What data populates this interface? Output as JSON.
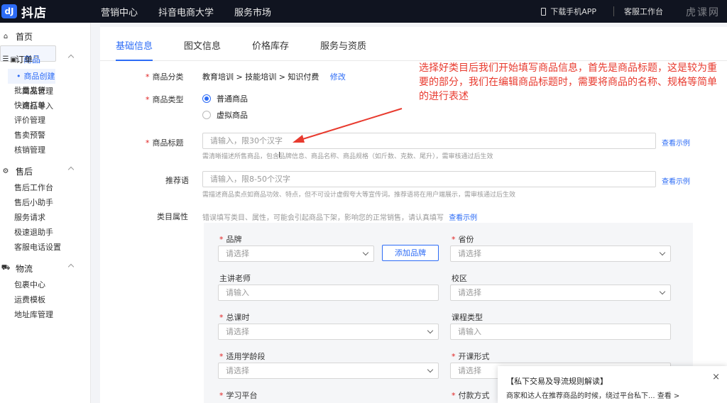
{
  "topbar": {
    "logo_mark": "dJ",
    "logo_text": "抖店",
    "nav": [
      "营销中心",
      "抖音电商大学",
      "服务市场"
    ],
    "download_app": "下载手机APP",
    "customer_service": "客服工作台",
    "watermark": "虎课网"
  },
  "sidebar": {
    "home": "首页",
    "groups": [
      {
        "title": "商品",
        "items": [
          "商品创建",
          "商品管理",
          "商品导入"
        ]
      },
      {
        "title": "订单",
        "items": [
          "订单管理",
          "批量发货",
          "快速打单",
          "评价管理",
          "售卖预警",
          "核销管理"
        ]
      },
      {
        "title": "售后",
        "items": [
          "售后工作台",
          "售后小助手",
          "服务请求",
          "极速退助手",
          "客服电话设置"
        ]
      },
      {
        "title": "物流",
        "items": [
          "包裹中心",
          "运费模板",
          "地址库管理"
        ]
      }
    ]
  },
  "tabs": [
    "基础信息",
    "图文信息",
    "价格库存",
    "服务与资质"
  ],
  "form": {
    "category_label": "商品分类",
    "category_value": "教育培训 > 技能培训 > 知识付费",
    "category_edit": "修改",
    "type_label": "商品类型",
    "type_options": [
      "普通商品",
      "虚拟商品"
    ],
    "title_label": "商品标题",
    "title_placeholder": "请输入，限30个汉字",
    "title_hint": "需清晰描述所售商品，包含品牌信息、商品名称、商品规格（如斤数、克数、尾升），需审核通过后生效",
    "title_example": "查看示例",
    "rec_label": "推荐语",
    "rec_placeholder": "请输入，限8-50个汉字",
    "rec_hint": "需描述商品卖点如商品功效、特点，但不可设计虚假夸大等宣传词。推荐语将在用户端展示，需审核通过后生效",
    "rec_example": "查看示例",
    "attr_label": "类目属性",
    "attr_hint": "错误填写类目、属性，可能会引起商品下架，影响您的正常销售，请认真填写",
    "attr_example": "查看示例"
  },
  "attributes": {
    "brand": {
      "label": "品牌",
      "placeholder": "请选择",
      "add_button": "添加品牌"
    },
    "province": {
      "label": "省份",
      "placeholder": "请选择"
    },
    "teacher": {
      "label": "主讲老师",
      "placeholder": "请输入"
    },
    "campus": {
      "label": "校区",
      "placeholder": "请选择"
    },
    "total_hours": {
      "label": "总课时",
      "placeholder": "请选择"
    },
    "course_type": {
      "label": "课程类型",
      "placeholder": "请输入"
    },
    "age_range": {
      "label": "适用学龄段",
      "placeholder": "请选择"
    },
    "format": {
      "label": "开课形式",
      "placeholder": "请选择"
    },
    "platform": {
      "label": "学习平台"
    },
    "payment": {
      "label": "付款方式"
    }
  },
  "annotation": "选择好类目后我们开始填写商品信息，首先是商品标题，这是较为重要的部分，我们在编辑商品标题时，需要将商品的名称、规格等简单的进行表述",
  "notice": {
    "title": "【私下交易及导流规则解读】",
    "body": "商家和达人在推荐商品的时候，绕过平台私下... 查看 >",
    "close": "×"
  },
  "colors": {
    "accent": "#2d6cf6",
    "annotation": "#e83a2e",
    "required": "#e02020"
  }
}
